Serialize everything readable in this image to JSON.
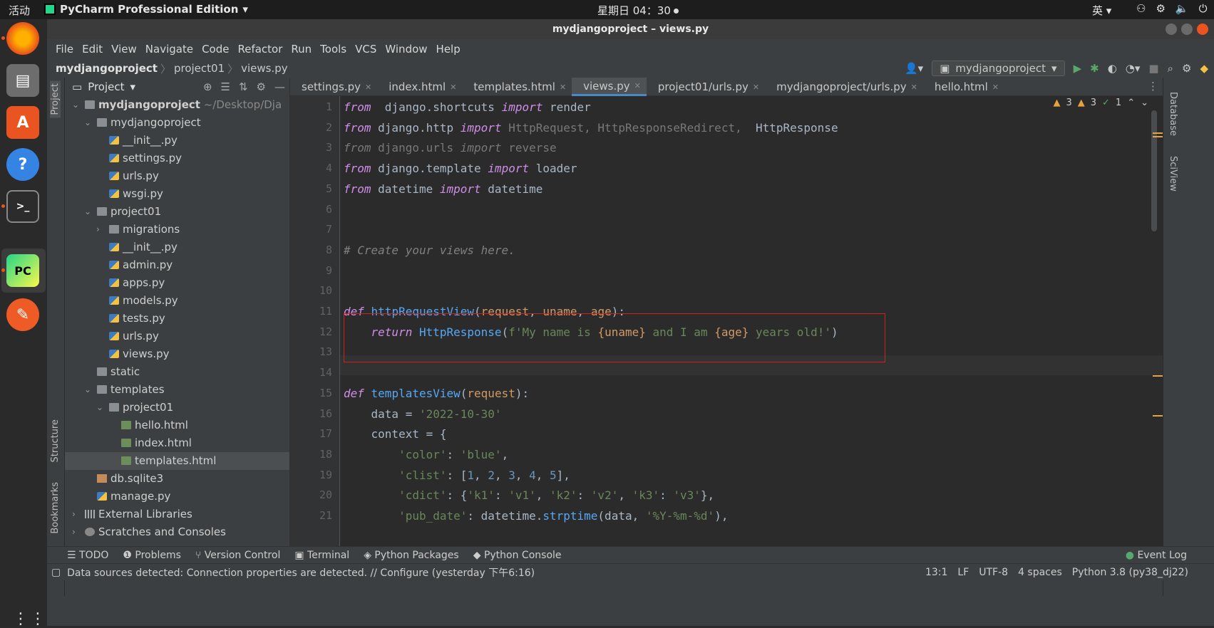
{
  "topbar": {
    "activities": "活动",
    "app": "PyCharm Professional Edition",
    "clock": "星期日 04：30",
    "lang": "英"
  },
  "window": {
    "title": "mydjangoproject – views.py"
  },
  "menu": [
    "File",
    "Edit",
    "View",
    "Navigate",
    "Code",
    "Refactor",
    "Run",
    "Tools",
    "VCS",
    "Window",
    "Help"
  ],
  "nav": {
    "project": "mydjangoproject",
    "folder": "project01",
    "file": "views.py",
    "run_config": "mydjangoproject"
  },
  "project_panel": {
    "title": "Project",
    "tree": [
      {
        "label": "mydjangoproject",
        "extra": "~/Desktop/Dja",
        "depth": 0,
        "type": "folder",
        "arrow": "v",
        "bold": true
      },
      {
        "label": "mydjangoproject",
        "depth": 1,
        "type": "folder",
        "arrow": "v"
      },
      {
        "label": "__init__.py",
        "depth": 2,
        "type": "py"
      },
      {
        "label": "settings.py",
        "depth": 2,
        "type": "py"
      },
      {
        "label": "urls.py",
        "depth": 2,
        "type": "py"
      },
      {
        "label": "wsgi.py",
        "depth": 2,
        "type": "py"
      },
      {
        "label": "project01",
        "depth": 1,
        "type": "folder",
        "arrow": "v"
      },
      {
        "label": "migrations",
        "depth": 2,
        "type": "folder",
        "arrow": ">"
      },
      {
        "label": "__init__.py",
        "depth": 2,
        "type": "py"
      },
      {
        "label": "admin.py",
        "depth": 2,
        "type": "py"
      },
      {
        "label": "apps.py",
        "depth": 2,
        "type": "py"
      },
      {
        "label": "models.py",
        "depth": 2,
        "type": "py"
      },
      {
        "label": "tests.py",
        "depth": 2,
        "type": "py"
      },
      {
        "label": "urls.py",
        "depth": 2,
        "type": "py"
      },
      {
        "label": "views.py",
        "depth": 2,
        "type": "py"
      },
      {
        "label": "static",
        "depth": 1,
        "type": "folder"
      },
      {
        "label": "templates",
        "depth": 1,
        "type": "folder",
        "arrow": "v"
      },
      {
        "label": "project01",
        "depth": 2,
        "type": "folder",
        "arrow": "v"
      },
      {
        "label": "hello.html",
        "depth": 3,
        "type": "html"
      },
      {
        "label": "index.html",
        "depth": 3,
        "type": "html"
      },
      {
        "label": "templates.html",
        "depth": 3,
        "type": "html",
        "selected": true
      },
      {
        "label": "db.sqlite3",
        "depth": 1,
        "type": "db"
      },
      {
        "label": "manage.py",
        "depth": 1,
        "type": "py"
      },
      {
        "label": "External Libraries",
        "depth": 0,
        "type": "lib",
        "arrow": ">"
      },
      {
        "label": "Scratches and Consoles",
        "depth": 0,
        "type": "scr",
        "arrow": ">"
      }
    ]
  },
  "tabs": [
    {
      "label": "settings.py",
      "icon": "py"
    },
    {
      "label": "index.html",
      "icon": "html"
    },
    {
      "label": "templates.html",
      "icon": "html"
    },
    {
      "label": "views.py",
      "icon": "py",
      "active": true
    },
    {
      "label": "project01/urls.py",
      "icon": "py"
    },
    {
      "label": "mydjangoproject/urls.py",
      "icon": "py"
    },
    {
      "label": "hello.html",
      "icon": "html"
    }
  ],
  "inspections": {
    "warn1": "3",
    "warn2": "3",
    "ok": "1"
  },
  "side_labels": {
    "project": "Project",
    "structure": "Structure",
    "bookmarks": "Bookmarks",
    "database": "Database",
    "sciview": "SciView"
  },
  "code_lines": [
    [
      [
        "kwp",
        "from"
      ],
      [
        "",
        "  django.shortcuts "
      ],
      [
        "kwp",
        "import"
      ],
      [
        "",
        " render"
      ]
    ],
    [
      [
        "kwp",
        "from"
      ],
      [
        "",
        " django.http "
      ],
      [
        "kwp",
        "import"
      ],
      [
        "dim",
        " HttpRequest, HttpResponseRedirect, "
      ],
      [
        "",
        " HttpResponse"
      ]
    ],
    [
      [
        "kwp dim",
        "from"
      ],
      [
        "dim",
        " django.urls "
      ],
      [
        "kwp dim",
        "import"
      ],
      [
        "dim",
        " reverse"
      ]
    ],
    [
      [
        "kwp",
        "from"
      ],
      [
        "",
        " django.template "
      ],
      [
        "kwp",
        "import"
      ],
      [
        "",
        " loader"
      ]
    ],
    [
      [
        "kwp",
        "from"
      ],
      [
        "",
        " datetime "
      ],
      [
        "kwp",
        "import"
      ],
      [
        "",
        " datetime"
      ]
    ],
    [],
    [],
    [
      [
        "cm",
        "# Create your views here."
      ]
    ],
    [],
    [],
    [
      [
        "kwp",
        "def"
      ],
      [
        "fn",
        " httpRequestView"
      ],
      [
        "",
        "("
      ],
      [
        "par",
        "request"
      ],
      [
        "",
        ", "
      ],
      [
        "par",
        "uname"
      ],
      [
        "",
        ", "
      ],
      [
        "par",
        "age"
      ],
      [
        "",
        "):"
      ]
    ],
    [
      [
        "",
        "    "
      ],
      [
        "kwp",
        "return"
      ],
      [
        "fn",
        " HttpResponse"
      ],
      [
        "",
        "("
      ],
      [
        "str",
        "f'My name is "
      ],
      [
        "par",
        "{uname}"
      ],
      [
        "str",
        " and I am "
      ],
      [
        "par",
        "{age}"
      ],
      [
        "str",
        " years old!'"
      ],
      [
        "",
        ")"
      ]
    ],
    [],
    [],
    [
      [
        "kwp",
        "def"
      ],
      [
        "fn",
        " templatesView"
      ],
      [
        "",
        "("
      ],
      [
        "par",
        "request"
      ],
      [
        "",
        "):"
      ]
    ],
    [
      [
        "",
        "    data = "
      ],
      [
        "str",
        "'2022-10-30'"
      ]
    ],
    [
      [
        "",
        "    context = {"
      ]
    ],
    [
      [
        "",
        "        "
      ],
      [
        "str",
        "'color'"
      ],
      [
        "",
        ": "
      ],
      [
        "str",
        "'blue'"
      ],
      [
        "",
        ","
      ]
    ],
    [
      [
        "",
        "        "
      ],
      [
        "str",
        "'clist'"
      ],
      [
        "",
        ": ["
      ],
      [
        "num",
        "1"
      ],
      [
        "",
        ", "
      ],
      [
        "num",
        "2"
      ],
      [
        "",
        ", "
      ],
      [
        "num",
        "3"
      ],
      [
        "",
        ", "
      ],
      [
        "num",
        "4"
      ],
      [
        "",
        ", "
      ],
      [
        "num",
        "5"
      ],
      [
        "",
        "],"
      ]
    ],
    [
      [
        "",
        "        "
      ],
      [
        "str",
        "'cdict'"
      ],
      [
        "",
        ": {"
      ],
      [
        "str",
        "'k1'"
      ],
      [
        "",
        ": "
      ],
      [
        "str",
        "'v1'"
      ],
      [
        "",
        ", "
      ],
      [
        "str",
        "'k2'"
      ],
      [
        "",
        ": "
      ],
      [
        "str",
        "'v2'"
      ],
      [
        "",
        ", "
      ],
      [
        "str",
        "'k3'"
      ],
      [
        "",
        ": "
      ],
      [
        "str",
        "'v3'"
      ],
      [
        "",
        "},"
      ]
    ],
    [
      [
        "",
        "        "
      ],
      [
        "str",
        "'pub_date'"
      ],
      [
        "",
        ": datetime."
      ],
      [
        "fn",
        "strptime"
      ],
      [
        "",
        "(data, "
      ],
      [
        "str",
        "'%Y-%m-%d'"
      ],
      [
        "",
        "),"
      ]
    ]
  ],
  "bottom_tools": [
    "TODO",
    "Problems",
    "Version Control",
    "Terminal",
    "Python Packages",
    "Python Console"
  ],
  "event_log": "Event Log",
  "status": {
    "message": "Data sources detected: Connection properties are detected. // Configure (yesterday 下午6:16)",
    "pos": "13:1",
    "sep": "LF",
    "enc": "UTF-8",
    "indent": "4 spaces",
    "interp": "Python 3.8 (py38_dj22)"
  }
}
